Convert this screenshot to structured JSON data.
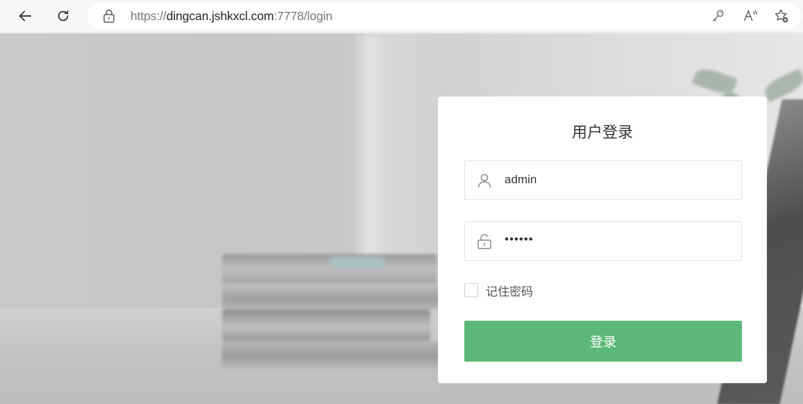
{
  "browser": {
    "url_scheme": "https://",
    "url_host": "dingcan.jshkxcl.com",
    "url_rest": ":7778/login",
    "icons": {
      "back": "arrow-left-icon",
      "reload": "reload-icon",
      "lock": "lock-icon",
      "key": "key-icon",
      "read_aloud": "read-aloud-icon",
      "favorite": "star-add-icon"
    }
  },
  "login": {
    "title": "用户登录",
    "username": "admin",
    "password_masked": "••••••",
    "remember_label": "记住密码",
    "remember_checked": false,
    "submit_label": "登录",
    "accent_color": "#5cb878"
  }
}
